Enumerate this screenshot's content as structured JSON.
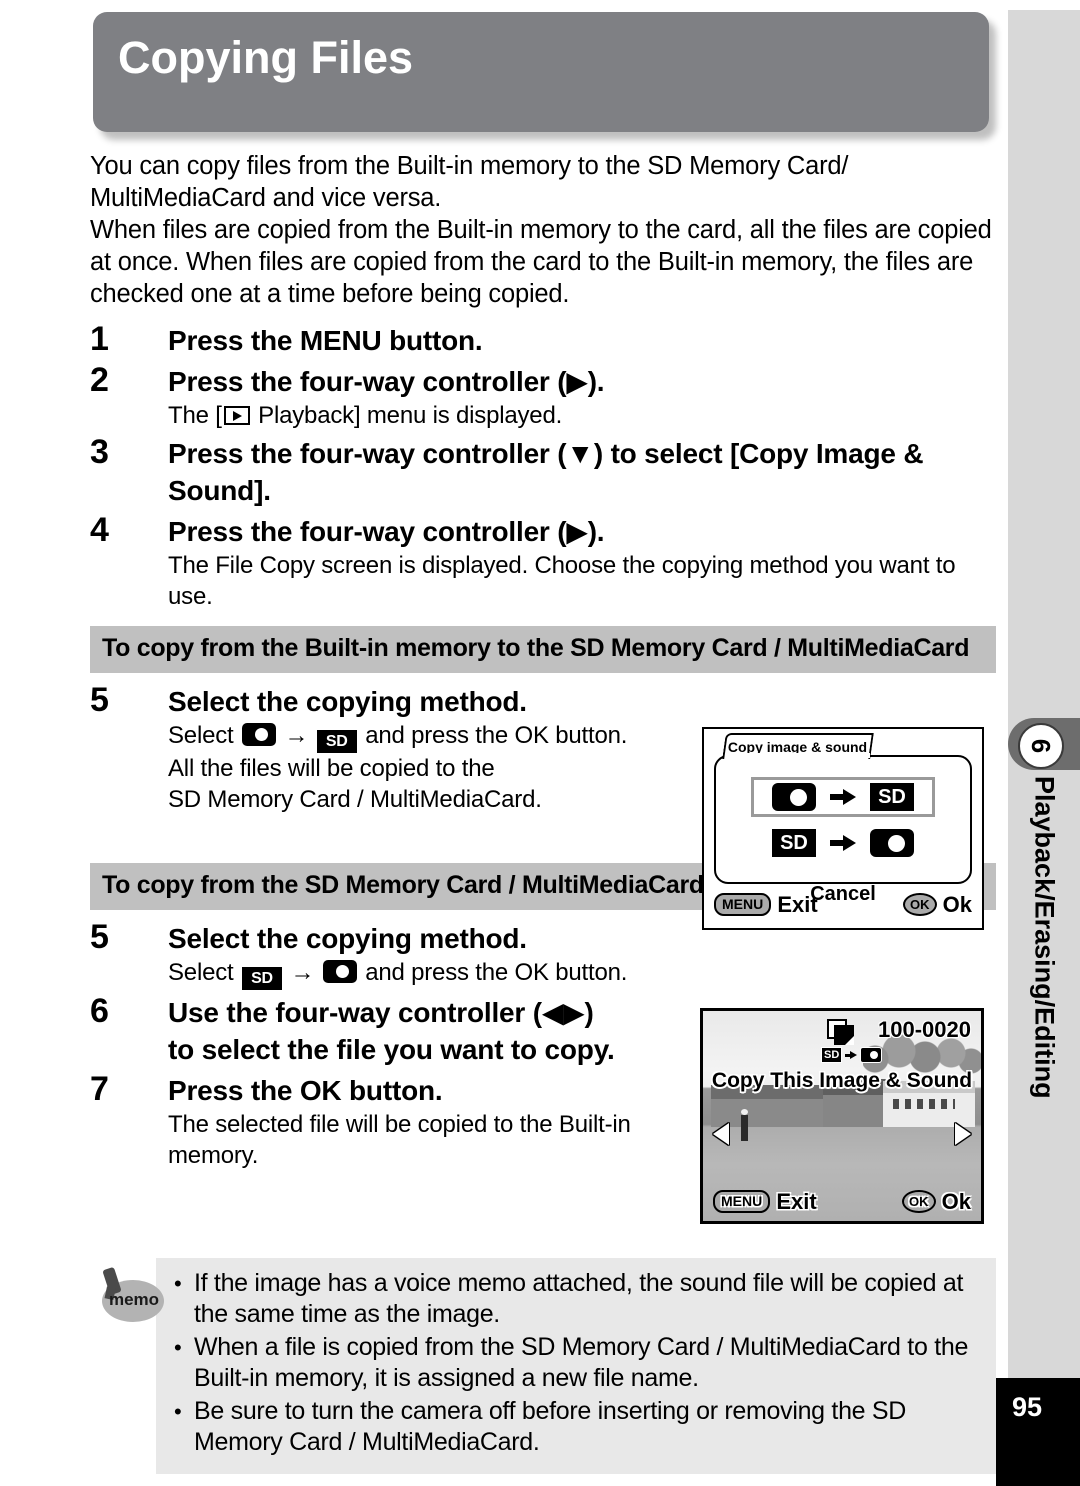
{
  "page": {
    "title": "Copying Files",
    "number": "95"
  },
  "sidebar": {
    "chapter_number": "6",
    "label": "Playback/Erasing/Editing"
  },
  "intro": {
    "paragraph1": "You can copy files from the Built-in memory to the SD Memory Card/ MultiMediaCard and vice versa.",
    "paragraph2": "When files are copied from the Built-in memory to the card, all the files are copied at once. When files are copied from the card to the Built-in memory, the files are checked one at a time before being copied."
  },
  "steps": {
    "s1": {
      "num": "1",
      "head": "Press the MENU button."
    },
    "s2": {
      "num": "2",
      "head_a": "Press the four-way controller (",
      "head_arrow": "▶",
      "head_b": ").",
      "sub_a": "The [",
      "sub_b": " Playback] menu is displayed."
    },
    "s3": {
      "num": "3",
      "head_a": "Press the four-way controller (",
      "head_arrow": "▼",
      "head_b": ") to select [Copy Image & Sound]."
    },
    "s4": {
      "num": "4",
      "head_a": "Press the four-way controller (",
      "head_arrow": "▶",
      "head_b": ").",
      "sub": "The File Copy screen is displayed. Choose the copying method you want to use."
    }
  },
  "section1": {
    "header": "To copy from the Built-in memory to the SD Memory Card / MultiMediaCard",
    "step5": {
      "num": "5",
      "head": "Select the copying method.",
      "sub_a": "Select ",
      "sub_arrow": "→",
      "sub_b": " and press the OK button.",
      "sub_line2": "All the files will be copied to the",
      "sub_line3": "SD Memory Card / MultiMediaCard."
    }
  },
  "section2": {
    "header": "To copy from the SD Memory Card / MultiMediaCard to the Built-in memory",
    "step5": {
      "num": "5",
      "head": "Select the copying method.",
      "sub_a": "Select ",
      "sub_arrow": "→",
      "sub_b": " and press the OK button."
    },
    "step6": {
      "num": "6",
      "head_a": "Use the four-way controller (",
      "head_arrows": "◀▶",
      "head_b": ")",
      "head_line2": "to select the file you want to copy."
    },
    "step7": {
      "num": "7",
      "head": "Press the OK button.",
      "sub": "The selected file will be copied to the Built-in memory."
    }
  },
  "screen1": {
    "tab_title": "Copy image & sound",
    "option1_left": "built-in-memory",
    "option1_right": "SD",
    "option2_left": "SD",
    "option2_right": "built-in-memory",
    "option3": "Cancel",
    "footer_menu_btn": "MENU",
    "footer_menu_label": "Exit",
    "footer_ok_btn": "OK",
    "footer_ok_label": "Ok"
  },
  "screen2": {
    "file_number": "100-0020",
    "sd_label": "SD",
    "caption": "Copy This Image & Sound",
    "footer_menu_btn": "MENU",
    "footer_menu_label": "Exit",
    "footer_ok_btn": "OK",
    "footer_ok_label": "Ok"
  },
  "memo": {
    "icon_label": "memo",
    "items": [
      "If the image has a voice memo attached, the sound file will be copied at the same time as the image.",
      "When a file is copied from the SD Memory Card / MultiMediaCard to the Built-in memory, it is assigned a new file name.",
      "Be sure to turn the camera off before inserting or removing the SD Memory Card / MultiMediaCard."
    ]
  }
}
